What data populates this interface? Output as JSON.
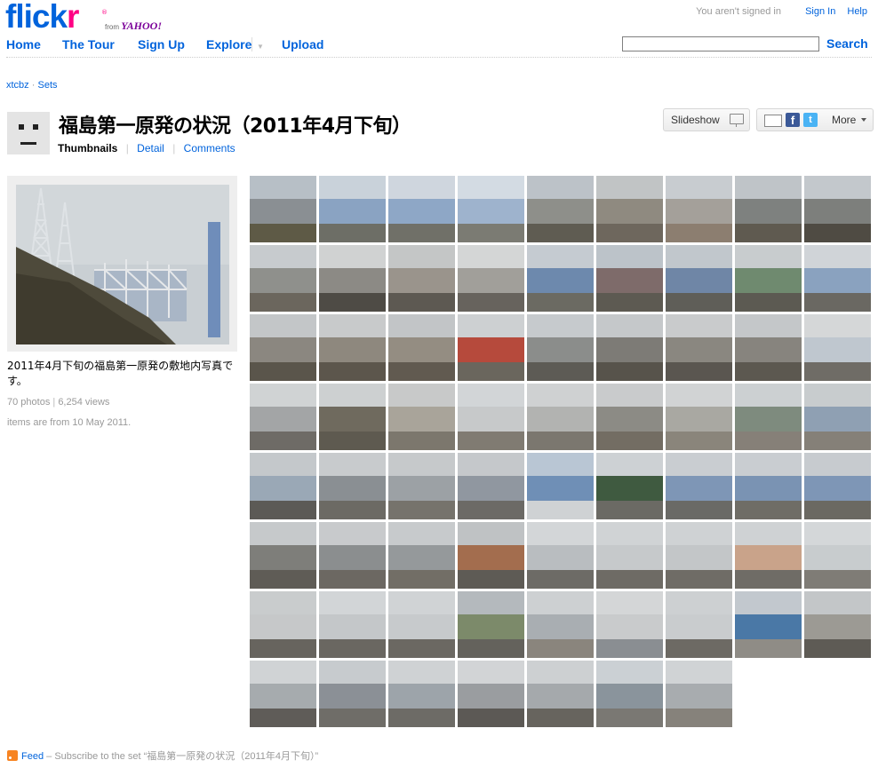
{
  "header": {
    "logo_flick": "flick",
    "logo_r": "r",
    "logo_reg": "®",
    "logo_from": "from",
    "logo_yahoo": "YAHOO!",
    "signin_status": "You aren't signed in",
    "signin_link": "Sign In",
    "help_link": "Help",
    "nav": {
      "home": "Home",
      "tour": "The Tour",
      "signup": "Sign Up",
      "explore": "Explore",
      "explore_caret": "▼",
      "upload": "Upload"
    },
    "search_value": "",
    "search_button": "Search"
  },
  "breadcrumb": {
    "user": "xtcbz",
    "sep": "·",
    "sets": "Sets"
  },
  "set": {
    "title": "福島第一原発の状況（2011年4月下旬）",
    "tab_thumbnails": "Thumbnails",
    "tab_detail": "Detail",
    "tab_comments": "Comments",
    "tab_sep": "|",
    "slideshow": "Slideshow",
    "share_fb": "f",
    "share_tw": "t",
    "more": "More",
    "description": "2011年4月下旬の福島第一原発の敷地内写真です。",
    "photo_count": "70 photos",
    "stats_sep": "|",
    "views": "6,254 views",
    "dated": "items are from 10 May 2011."
  },
  "thumbnails": {
    "count": 70,
    "columns": 9,
    "palettes": [
      [
        "#b7bfc6",
        "#8a8f93",
        "#5e5a46"
      ],
      [
        "#c9d2da",
        "#8aa3c2",
        "#6d6e66"
      ],
      [
        "#cfd6de",
        "#8ea7c6",
        "#707068"
      ],
      [
        "#d3dbe3",
        "#9eb3cd",
        "#7b7b73"
      ],
      [
        "#bcc2c8",
        "#8e8f8a",
        "#5f5c52"
      ],
      [
        "#c1c4c5",
        "#8f8a80",
        "#6e675d"
      ],
      [
        "#c8ccd0",
        "#a4a09a",
        "#8c7e70"
      ],
      [
        "#bfc4c8",
        "#7e817f",
        "#5f5a50"
      ],
      [
        "#c3c8cc",
        "#7d7f7c",
        "#4f4b43"
      ],
      [
        "#c7cbce",
        "#8f908c",
        "#6b665d"
      ],
      [
        "#d0d2d2",
        "#8c8a85",
        "#4e4b45"
      ],
      [
        "#c4c6c6",
        "#9a948c",
        "#5d5952"
      ],
      [
        "#d4d6d6",
        "#a19f9a",
        "#67635d"
      ],
      [
        "#c5cbd1",
        "#6d89ad",
        "#6b6a62"
      ],
      [
        "#bcc3c9",
        "#7e6b6a",
        "#5d5a52"
      ],
      [
        "#c1c7cc",
        "#6f86a6",
        "#5f5e58"
      ],
      [
        "#c8ccce",
        "#6f8a6f",
        "#5c5a52"
      ],
      [
        "#d0d4d8",
        "#8aa2bf",
        "#6a6862"
      ],
      [
        "#c3c6c8",
        "#8b8780",
        "#5a554b"
      ],
      [
        "#c8cacb",
        "#8e887e",
        "#5c564c"
      ],
      [
        "#c2c5c7",
        "#948d82",
        "#615a50"
      ],
      [
        "#cdd0d2",
        "#b64a3c",
        "#6a665d"
      ],
      [
        "#c6cacd",
        "#8b8d8b",
        "#5d5b55"
      ],
      [
        "#c5c8ca",
        "#7d7b76",
        "#57534b"
      ],
      [
        "#c9cbcc",
        "#8a8780",
        "#5a5650"
      ],
      [
        "#c4c7c9",
        "#87847e",
        "#5c5850"
      ],
      [
        "#d5d7d8",
        "#bfc7cf",
        "#6f6c66"
      ],
      [
        "#d0d3d4",
        "#a3a5a6",
        "#6e6b66"
      ],
      [
        "#cdd0d1",
        "#6f6a5e",
        "#5e5a50"
      ],
      [
        "#c8c9c9",
        "#a9a49a",
        "#7c776d"
      ],
      [
        "#d2d5d7",
        "#c7c9ca",
        "#807b72"
      ],
      [
        "#cfd1d2",
        "#b2b3b1",
        "#7b776f"
      ],
      [
        "#c9cbcc",
        "#8c8b85",
        "#736d63"
      ],
      [
        "#d1d3d4",
        "#a9a8a2",
        "#8a857b"
      ],
      [
        "#ccd0d2",
        "#7e8b7e",
        "#868078"
      ],
      [
        "#c8ccce",
        "#8fa0b3",
        "#858078"
      ],
      [
        "#c4c8cb",
        "#9aa8b6",
        "#5c5a56"
      ],
      [
        "#c8cbcd",
        "#8a8f93",
        "#6c6a64"
      ],
      [
        "#c6c9cb",
        "#9ca1a5",
        "#76736c"
      ],
      [
        "#c5c8cb",
        "#9097a0",
        "#6c6a66"
      ],
      [
        "#b9c6d4",
        "#6f8fb6",
        "#cfd2d4"
      ],
      [
        "#cdd1d4",
        "#3f5a40",
        "#6b6a64"
      ],
      [
        "#c9cdd1",
        "#7e96b6",
        "#6a6a66"
      ],
      [
        "#c9cdd1",
        "#7a93b3",
        "#6f6d66"
      ],
      [
        "#c7cbcf",
        "#7e96b6",
        "#6b6962"
      ],
      [
        "#c6c9cb",
        "#7e7e7a",
        "#5f5c56"
      ],
      [
        "#c8cacc",
        "#8b8e8f",
        "#6c6862"
      ],
      [
        "#c7cacc",
        "#95999b",
        "#726e66"
      ],
      [
        "#bfc2c4",
        "#a36d4e",
        "#5e5b55"
      ],
      [
        "#d3d6d8",
        "#b9bdc0",
        "#6d6b66"
      ],
      [
        "#d0d3d5",
        "#c6c9cb",
        "#6e6b65"
      ],
      [
        "#cfd2d4",
        "#c3c6c8",
        "#6f6c66"
      ],
      [
        "#cfd2d4",
        "#c9a38a",
        "#6f6c66"
      ],
      [
        "#d4d7d9",
        "#c8ccce",
        "#7f7c76"
      ],
      [
        "#c9cccd",
        "#c6c8c9",
        "#67645e"
      ],
      [
        "#d2d5d7",
        "#c4c7c9",
        "#6a6761"
      ],
      [
        "#d0d3d5",
        "#c7cacc",
        "#6b6862"
      ],
      [
        "#b4b9bd",
        "#7c8a6a",
        "#64625c"
      ],
      [
        "#cdd0d2",
        "#a9aeb2",
        "#8a857d"
      ],
      [
        "#d4d6d7",
        "#c9cbcc",
        "#8a8e92"
      ],
      [
        "#cdd0d2",
        "#c9ccce",
        "#6d6a64"
      ],
      [
        "#c2c8ce",
        "#4a78a6",
        "#8f8c86"
      ],
      [
        "#c3c6c8",
        "#9c9a94",
        "#5e5b55"
      ],
      [
        "#d0d3d5",
        "#a6abae",
        "#5f5c58"
      ],
      [
        "#c7cbce",
        "#8b9096",
        "#6f6d68"
      ],
      [
        "#cfd2d4",
        "#9da4aa",
        "#6d6b66"
      ],
      [
        "#d2d4d6",
        "#9a9da0",
        "#5c5955"
      ],
      [
        "#cdd0d2",
        "#a5a9ac",
        "#67645e"
      ],
      [
        "#cbd0d4",
        "#8a949c",
        "#7a7873"
      ],
      [
        "#d0d3d5",
        "#a8acaf",
        "#86827b"
      ]
    ]
  },
  "footer": {
    "feed_link": "Feed",
    "feed_text": "– Subscribe to the set “福島第一原発の状況（2011年4月下旬）”"
  }
}
